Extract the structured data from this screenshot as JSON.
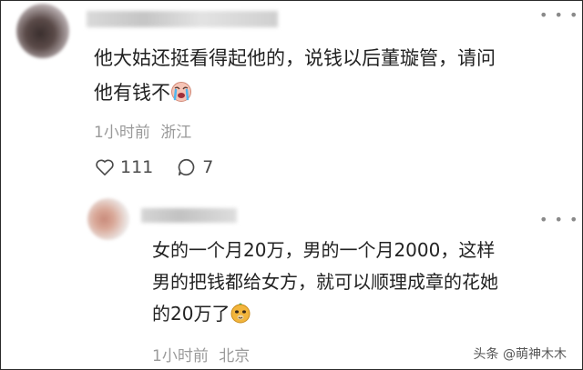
{
  "comment": {
    "text_line1": "他大姑还挺看得起他的，说钱以后董璇管，请问",
    "text_line2": "他有钱不",
    "emoji": "crying-face-emoji",
    "time": "1小时前",
    "location": "浙江",
    "likes": "111",
    "replies": "7"
  },
  "reply": {
    "text_line1": "女的一个月20万，男的一个月2000，这样",
    "text_line2": "男的把钱都给女方，就可以顺理成章的花她",
    "text_line3": "的20万了",
    "emoji": "smirk-face-emoji",
    "time": "1小时前",
    "location": "北京"
  },
  "more_icon": "more-dots-icon",
  "watermark": "头条 @萌神木木",
  "colors": {
    "text": "#222222",
    "meta": "#9a9a9a",
    "icon": "#4a4a4a"
  }
}
